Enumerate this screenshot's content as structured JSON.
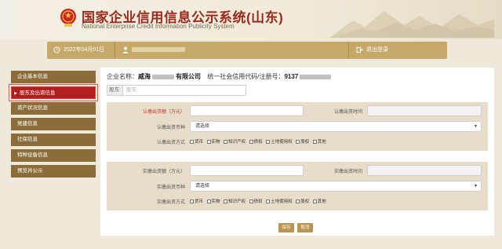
{
  "header": {
    "title_cn": "国家企业信用信息公示系统(山东)",
    "title_en": "National Enterprise Credit Information Publicity System"
  },
  "topbar": {
    "date": "2022年04月01日",
    "logout": "退出登录"
  },
  "sidebar": {
    "items": [
      {
        "label": "企业基本信息"
      },
      {
        "label": "股东及出资信息",
        "active": true
      },
      {
        "label": "资产状况信息"
      },
      {
        "label": "党建信息"
      },
      {
        "label": "社保信息"
      },
      {
        "label": "特种设备信息"
      },
      {
        "label": "预览并公示"
      }
    ]
  },
  "main": {
    "company_label": "企业名称：",
    "company_name_visible_prefix": "威海",
    "company_name_visible_suffix": "有限公司",
    "credit_label": "统一社会信用代码/注册号：",
    "credit_code_visible": "9137",
    "shareholder_label": "股东:",
    "shareholder_placeholder": "股东",
    "subscribed": {
      "amount_label": "认缴出资额（万元）",
      "time_label": "认缴出资时间",
      "currency_label": "认缴出资币种",
      "currency_value": "请选择",
      "method_label": "认缴出资方式"
    },
    "paid": {
      "amount_label": "实缴出资额（万元）",
      "time_label": "实缴出资时间",
      "currency_label": "实缴出资币种",
      "currency_value": "请选择",
      "method_label": "实缴出资方式"
    },
    "methods": [
      "货币",
      "实物",
      "知识产权",
      "债权",
      "土地使用权",
      "股权",
      "其他"
    ],
    "save_label": "保存",
    "cancel_label": "取消"
  },
  "colors": {
    "brand_red": "#9a2a1c",
    "gold": "#c6a968",
    "sidebar_brown": "#8c6d3a",
    "active_red": "#b01e1e"
  },
  "icons": [
    "emblem-icon",
    "clock-icon",
    "user-icon",
    "logout-icon",
    "chevron-down-icon"
  ]
}
